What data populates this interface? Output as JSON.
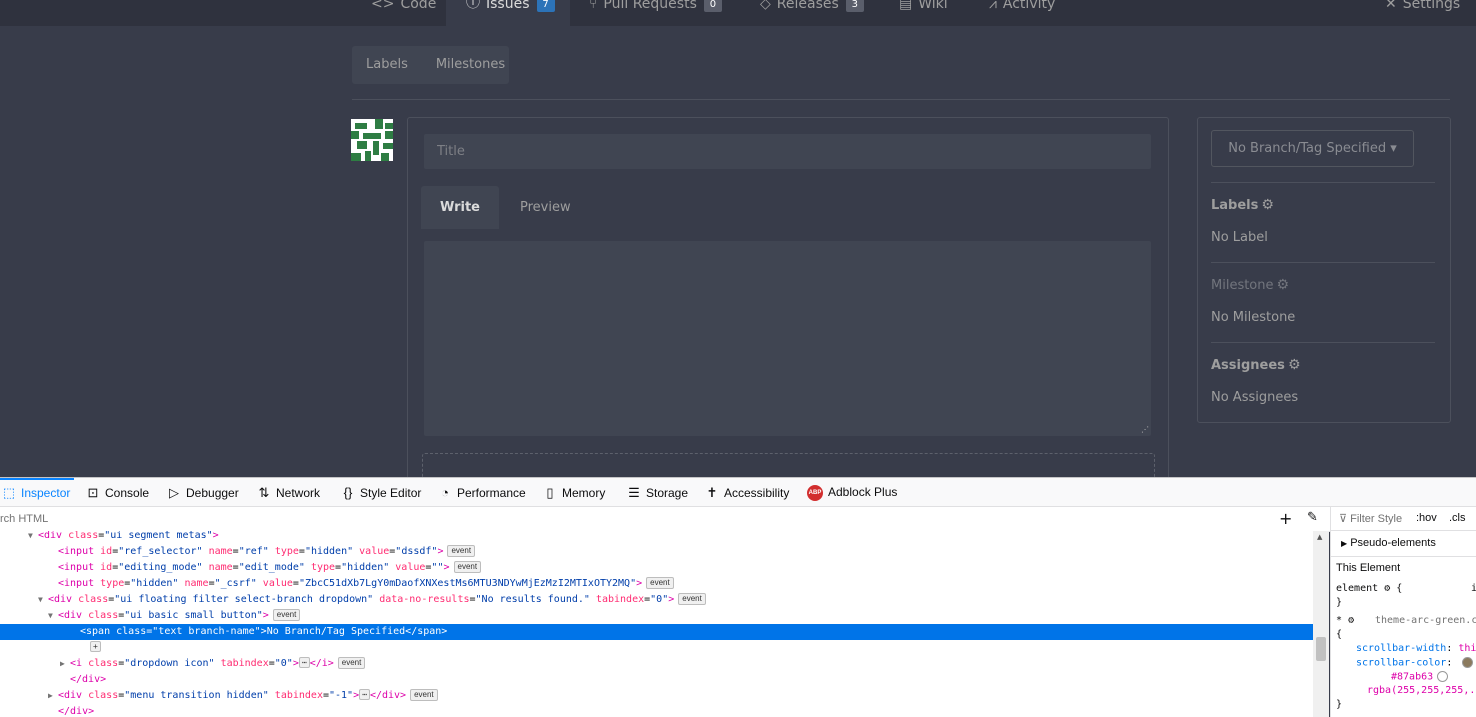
{
  "repo_nav": {
    "tabs": [
      {
        "label": "Code",
        "icon": "code-icon"
      },
      {
        "label": "Issues",
        "icon": "issue-icon",
        "count": "7",
        "active": true
      },
      {
        "label": "Pull Requests",
        "icon": "pull-request-icon",
        "count": "0"
      },
      {
        "label": "Releases",
        "icon": "tag-icon",
        "count": "3"
      },
      {
        "label": "Wiki",
        "icon": "book-icon"
      },
      {
        "label": "Activity",
        "icon": "pulse-icon"
      },
      {
        "label": "Settings",
        "icon": "tools-icon"
      }
    ]
  },
  "subnav": {
    "labels": "Labels",
    "milestones": "Milestones"
  },
  "form": {
    "title_placeholder": "Title",
    "write_tab": "Write",
    "preview_tab": "Preview"
  },
  "sidebar": {
    "branch_button": "No Branch/Tag Specified",
    "labels_heading": "Labels",
    "labels_value": "No Label",
    "milestone_heading": "Milestone",
    "milestone_value": "No Milestone",
    "assignees_heading": "Assignees",
    "assignees_value": "No Assignees"
  },
  "devtools": {
    "tabs": [
      "Inspector",
      "Console",
      "Debugger",
      "Network",
      "Style Editor",
      "Performance",
      "Memory",
      "Storage",
      "Accessibility",
      "Adblock Plus"
    ],
    "selected_tab": "Inspector",
    "search_placeholder": "rch HTML",
    "markup_lines": [
      {
        "indent": 38,
        "twisty": "▼",
        "html": "<span class=\"tg\">&lt;div</span> <span class=\"an\">class</span>=<span class=\"av\">\"ui segment metas\"</span><span class=\"tg\">&gt;</span>"
      },
      {
        "indent": 58,
        "html": "<span class=\"tg\">&lt;input</span> <span class=\"an\">id</span>=<span class=\"av\">\"ref_selector\"</span> <span class=\"an\">name</span>=<span class=\"av\">\"ref\"</span> <span class=\"an\">type</span>=<span class=\"av\">\"hidden\"</span> <span class=\"an\">value</span>=<span class=\"av\">\"dssdf\"</span><span class=\"tg\">&gt;</span>",
        "event": true
      },
      {
        "indent": 58,
        "html": "<span class=\"tg\">&lt;input</span> <span class=\"an\">id</span>=<span class=\"av\">\"editing_mode\"</span> <span class=\"an\">name</span>=<span class=\"av\">\"edit_mode\"</span> <span class=\"an\">type</span>=<span class=\"av\">\"hidden\"</span> <span class=\"an\">value</span>=<span class=\"av\">\"\"</span><span class=\"tg\">&gt;</span>",
        "event": true
      },
      {
        "indent": 58,
        "html": "<span class=\"tg\">&lt;input</span> <span class=\"an\">type</span>=<span class=\"av\">\"hidden\"</span> <span class=\"an\">name</span>=<span class=\"av\">\"_csrf\"</span> <span class=\"an\">value</span>=<span class=\"av\">\"ZbcC51dXb7LgY0mDaofXNXestMs6MTU3NDYwMjEzMzI2MTIxOTY2MQ\"</span><span class=\"tg\">&gt;</span>",
        "event": true
      },
      {
        "indent": 48,
        "twisty": "▼",
        "html": "<span class=\"tg\">&lt;div</span> <span class=\"an\">class</span>=<span class=\"av\">\"ui floating filter select-branch dropdown\"</span> <span class=\"an\">data-no-results</span>=<span class=\"av\">\"No results found.\"</span> <span class=\"an\">tabindex</span>=<span class=\"av\">\"0\"</span><span class=\"tg\">&gt;</span>",
        "event": true
      },
      {
        "indent": 58,
        "twisty": "▼",
        "html": "<span class=\"tg\">&lt;div</span> <span class=\"an\">class</span>=<span class=\"av\">\"ui basic small button\"</span><span class=\"tg\">&gt;</span>",
        "event": true
      },
      {
        "indent": 80,
        "selected": true,
        "html": "<span class=\"tg\">&lt;span</span> <span class=\"an\">class</span>=<span class=\"av\">\"text branch-name\"</span><span class=\"tg\">&gt;</span>No Branch/Tag Specified<span class=\"tg\">&lt;/span&gt;</span>"
      },
      {
        "indent": 90,
        "html": "<span class=\"ell\">+</span>"
      },
      {
        "indent": 70,
        "twisty": "▶",
        "html": "<span class=\"tg\">&lt;i</span> <span class=\"an\">class</span>=<span class=\"av\">\"dropdown icon\"</span> <span class=\"an\">tabindex</span>=<span class=\"av\">\"0\"</span><span class=\"tg\">&gt;</span><span class=\"ell\">⋯</span><span class=\"tg\">&lt;/i&gt;</span>",
        "event": true
      },
      {
        "indent": 70,
        "html": "<span class=\"tg\">&lt;/div&gt;</span>"
      },
      {
        "indent": 58,
        "twisty": "▶",
        "html": "<span class=\"tg\">&lt;div</span> <span class=\"an\">class</span>=<span class=\"av\">\"menu transition hidden\"</span> <span class=\"an\">tabindex</span>=<span class=\"av\">\"-1\"</span><span class=\"tg\">&gt;</span><span class=\"ell\">⋯</span><span class=\"tg\">&lt;/div&gt;</span>",
        "event": true
      },
      {
        "indent": 58,
        "html": "<span class=\"tg\">&lt;/div&gt;</span>"
      }
    ],
    "event_badge": "event",
    "rules": {
      "filter_placeholder": "Filter Style",
      "hov": ":hov",
      "cls": ".cls",
      "pseudo_elements": "Pseudo-elements",
      "this_element": "This Element",
      "element_rule": "element",
      "element_rule_brace": "{",
      "element_rule_trail": "i",
      "close_brace": "}",
      "star": "*",
      "stylesheet": "theme-arc-green.c",
      "open_brace": "{",
      "scrollbar_width_prop": "scrollbar-width",
      "scrollbar_width_val": "thi",
      "scrollbar_color_prop": "scrollbar-color",
      "color_hex": "#87ab63",
      "color_rgba": "rgba(255,255,255,.1",
      "swatch_brown": "#8b7a5e",
      "swatch_green": "#87ab63",
      "swatch_white": "#ffffff"
    }
  }
}
